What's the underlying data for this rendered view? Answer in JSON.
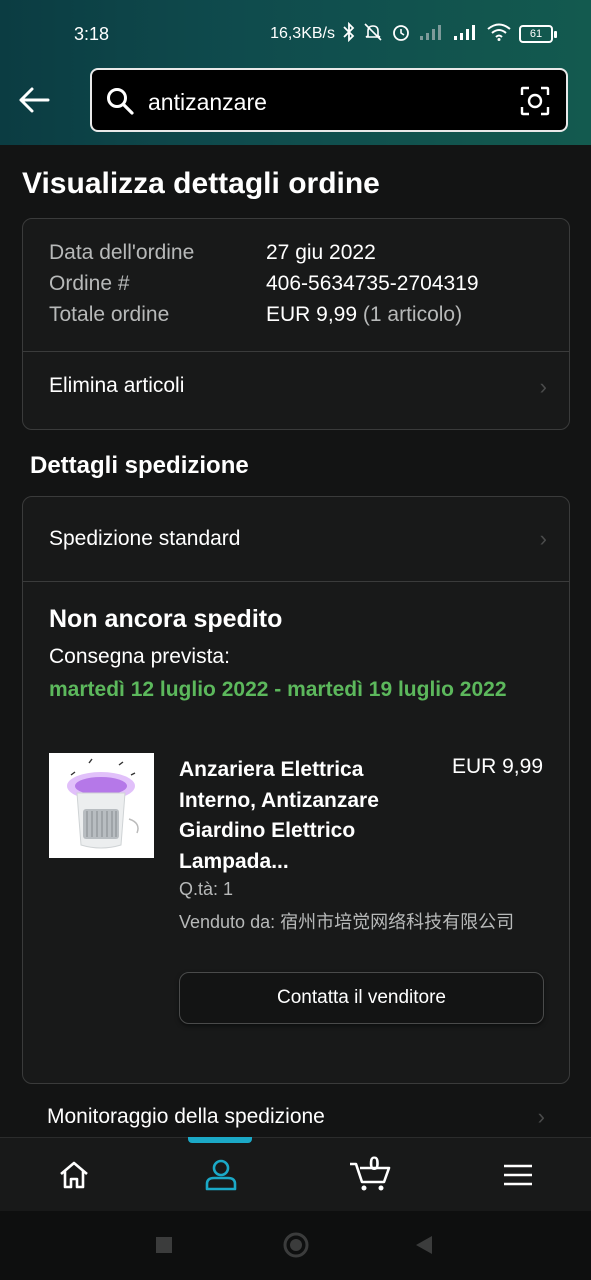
{
  "status_bar": {
    "time": "3:18",
    "network_speed": "16,3KB/s",
    "battery": "61"
  },
  "search": {
    "query": "antizanzare"
  },
  "page": {
    "title": "Visualizza dettagli ordine"
  },
  "order_summary": {
    "rows": [
      {
        "label": "Data dell'ordine",
        "value": "27 giu 2022",
        "extra": ""
      },
      {
        "label": "Ordine #",
        "value": "406-5634735-2704319",
        "extra": ""
      },
      {
        "label": "Totale ordine",
        "value": "EUR 9,99",
        "extra": "(1 articolo)"
      }
    ],
    "delete_items_label": "Elimina articoli"
  },
  "shipping": {
    "section_title": "Dettagli spedizione",
    "method": "Spedizione standard",
    "status": "Non ancora spedito",
    "eta_label": "Consegna prevista:",
    "eta_dates": "martedì 12 luglio 2022 - martedì 19 luglio 2022",
    "eta_color": "#5cb85c",
    "tracking_label": "Monitoraggio della spedizione"
  },
  "item": {
    "title": "Anzariera Elettrica Interno, Antizanzare Giardino Elettrico Lampada...",
    "price": "EUR 9,99",
    "quantity": "Q.tà: 1",
    "seller_label": "Venduto da:",
    "seller_name": "宿州市培觉网络科技有限公司",
    "contact_button": "Contatta il venditore"
  },
  "bottom_nav": {
    "items": [
      "home-icon",
      "account-icon",
      "cart-icon",
      "menu-icon"
    ],
    "cart_count": "0",
    "active_color": "#1ba9c7"
  }
}
